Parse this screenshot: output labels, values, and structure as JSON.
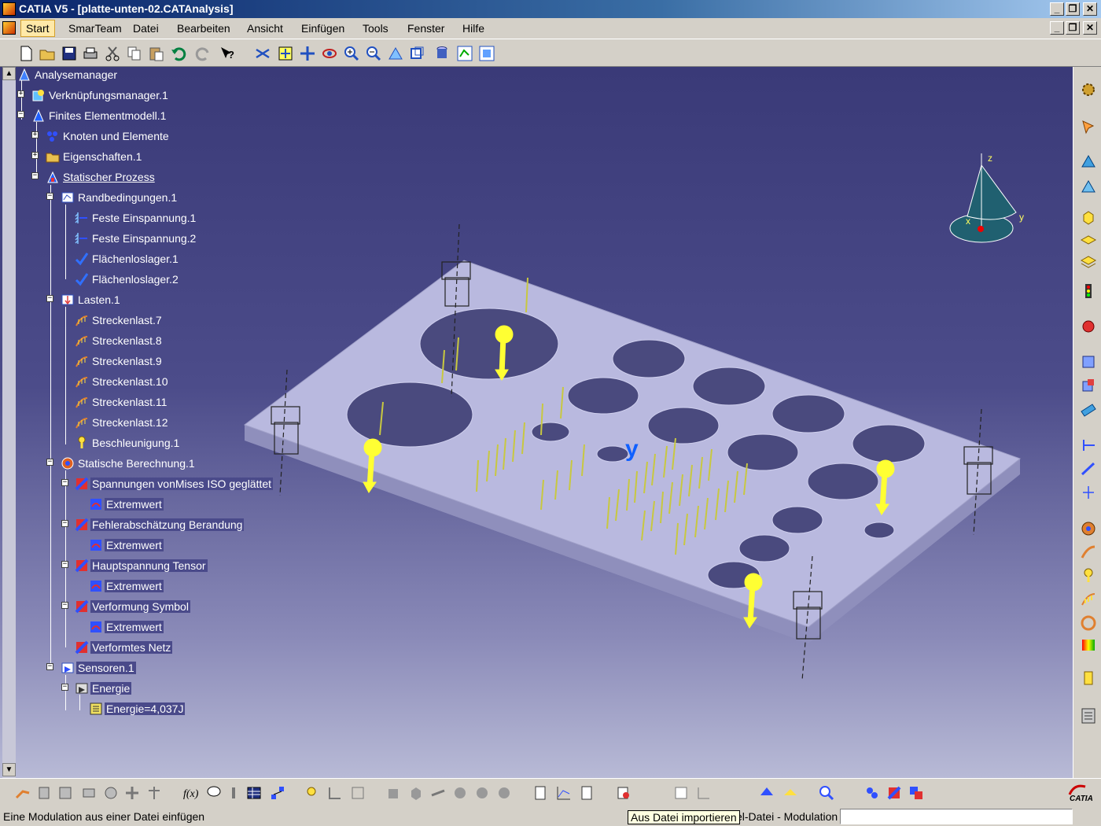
{
  "window": {
    "title": "CATIA V5 - [platte-unten-02.CATAnalysis]",
    "controls": [
      "_",
      "❐",
      "✕"
    ]
  },
  "menubar": {
    "items": [
      "Start",
      "SmarTeam",
      "Datei",
      "Bearbeiten",
      "Ansicht",
      "Einfügen",
      "Tools",
      "Fenster",
      "Hilfe"
    ],
    "active": "Start"
  },
  "tree": {
    "nodes": [
      {
        "label": "Analysemanager",
        "icon": "analysis-manager-icon"
      },
      {
        "label": "Verknüpfungsmanager.1",
        "icon": "link-manager-icon"
      },
      {
        "label": "Finites Elementmodell.1",
        "icon": "fem-model-icon"
      },
      {
        "label": "Knoten und Elemente",
        "icon": "nodes-elements-icon"
      },
      {
        "label": "Eigenschaften.1",
        "icon": "folder-icon"
      },
      {
        "label": "Statischer Prozess",
        "icon": "static-process-icon"
      },
      {
        "label": "Randbedingungen.1",
        "icon": "boundary-conditions-icon"
      },
      {
        "label": "Feste Einspannung.1",
        "icon": "clamp-icon"
      },
      {
        "label": "Feste Einspannung.2",
        "icon": "clamp-icon"
      },
      {
        "label": "Flächenloslager.1",
        "icon": "surface-slider-icon"
      },
      {
        "label": "Flächenloslager.2",
        "icon": "surface-slider-icon"
      },
      {
        "label": "Lasten.1",
        "icon": "loads-icon"
      },
      {
        "label": "Streckenlast.7",
        "icon": "line-load-icon"
      },
      {
        "label": "Streckenlast.8",
        "icon": "line-load-icon"
      },
      {
        "label": "Streckenlast.9",
        "icon": "line-load-icon"
      },
      {
        "label": "Streckenlast.10",
        "icon": "line-load-icon"
      },
      {
        "label": "Streckenlast.11",
        "icon": "line-load-icon"
      },
      {
        "label": "Streckenlast.12",
        "icon": "line-load-icon"
      },
      {
        "label": "Beschleunigung.1",
        "icon": "acceleration-icon"
      },
      {
        "label": "Statische Berechnung.1",
        "icon": "static-solution-icon"
      },
      {
        "label": "Spannungen vonMises ISO geglättet",
        "icon": "image-result-icon"
      },
      {
        "label": "Extremwert",
        "icon": "extremum-icon"
      },
      {
        "label": "Fehlerabschätzung Berandung",
        "icon": "image-result-icon"
      },
      {
        "label": "Extremwert",
        "icon": "extremum-icon"
      },
      {
        "label": "Hauptspannung Tensor",
        "icon": "image-result-icon"
      },
      {
        "label": "Extremwert",
        "icon": "extremum-icon"
      },
      {
        "label": "Verformung Symbol",
        "icon": "image-result-icon"
      },
      {
        "label": "Extremwert",
        "icon": "extremum-icon"
      },
      {
        "label": "Verformtes Netz",
        "icon": "image-result-icon"
      },
      {
        "label": "Sensoren.1",
        "icon": "sensors-icon"
      },
      {
        "label": "Energie",
        "icon": "sensor-icon"
      },
      {
        "label": "Energie=4,037J",
        "icon": "sensor-value-icon"
      }
    ]
  },
  "compass": {
    "axis_x": "x",
    "axis_y": "y",
    "axis_z": "z"
  },
  "axes_small": {
    "x": "x",
    "y": "y",
    "z": "z"
  },
  "status": {
    "text": "Eine Modulation aus einer Datei einfügen",
    "tooltip": "Aus Datei importieren",
    "mid": "el-Datei - Modulation",
    "command_value": ""
  },
  "brand": {
    "logo_text": "CATIA"
  },
  "colors": {
    "viewport_top": "#3a3a78",
    "plate": "#b9b9df",
    "load_arrow": "#ffff33"
  }
}
